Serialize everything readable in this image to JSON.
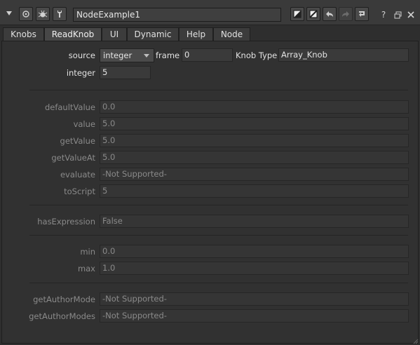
{
  "window": {
    "node_name": "NodeExample1",
    "help_label": "?"
  },
  "tabs": [
    {
      "label": "Knobs"
    },
    {
      "label": "ReadKnob"
    },
    {
      "label": "UI"
    },
    {
      "label": "Dynamic"
    },
    {
      "label": "Help"
    },
    {
      "label": "Node"
    }
  ],
  "active_tab": "ReadKnob",
  "controls": {
    "source_label": "source",
    "source_value": "integer",
    "frame_label": "frame",
    "frame_value": "0",
    "knob_type_label": "Knob Type",
    "knob_type_value": "Array_Knob",
    "integer_label": "integer",
    "integer_value": "5"
  },
  "results": {
    "defaultValue": {
      "label": "defaultValue",
      "value": "0.0"
    },
    "value": {
      "label": "value",
      "value": "5.0"
    },
    "getValue": {
      "label": "getValue",
      "value": "5.0"
    },
    "getValueAt": {
      "label": "getValueAt",
      "value": "5.0"
    },
    "evaluate": {
      "label": "evaluate",
      "value": "-Not Supported-"
    },
    "toScript": {
      "label": "toScript",
      "value": "5"
    },
    "hasExpression": {
      "label": "hasExpression",
      "value": "False"
    },
    "min": {
      "label": "min",
      "value": "0.0"
    },
    "max": {
      "label": "max",
      "value": "1.0"
    },
    "getAuthorMode": {
      "label": "getAuthorMode",
      "value": "-Not Supported-"
    },
    "getAuthorModes": {
      "label": "getAuthorModes",
      "value": "-Not Supported-"
    }
  }
}
